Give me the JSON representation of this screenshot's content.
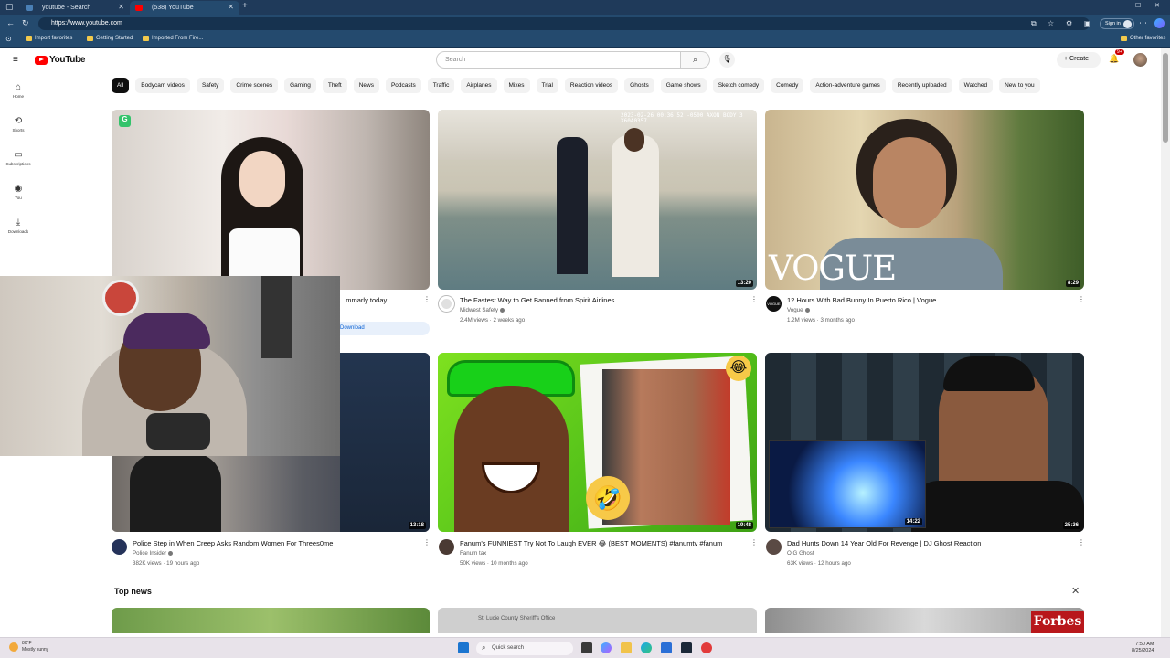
{
  "browser": {
    "tabs": [
      {
        "title": "youtube - Search",
        "active": false
      },
      {
        "title": "(538) YouTube",
        "active": true
      }
    ],
    "url": "https://www.youtube.com",
    "sign_in": "Sign in",
    "favorites": [
      "Import favorites",
      "Getting Started",
      "Imported From Fire...",
      "Other favorites"
    ]
  },
  "youtube": {
    "logo_text": "YouTube",
    "search_placeholder": "Search",
    "create_label": "Create",
    "notification_count": "9+",
    "chips": [
      "All",
      "Bodycam videos",
      "Safety",
      "Crime scenes",
      "Gaming",
      "Theft",
      "News",
      "Podcasts",
      "Traffic",
      "Airplanes",
      "Mixes",
      "Trial",
      "Reaction videos",
      "Ghosts",
      "Game shows",
      "Sketch comedy",
      "Comedy",
      "Action-adventure games",
      "Recently uploaded",
      "Watched",
      "New to you"
    ],
    "nav": [
      {
        "label": "Home",
        "icon": "home-icon"
      },
      {
        "label": "Shorts",
        "icon": "shorts-icon"
      },
      {
        "label": "Subscriptions",
        "icon": "subscriptions-icon"
      },
      {
        "label": "You",
        "icon": "you-icon"
      },
      {
        "label": "Downloads",
        "icon": "downloads-icon"
      }
    ],
    "videos": [
      {
        "title": "...mmarly today.",
        "channel": "",
        "meta": "",
        "duration": "",
        "extra": "Download"
      },
      {
        "title": "The Fastest Way to Get Banned from Spirit Airlines",
        "channel": "Midwest Safety",
        "meta": "2.4M views · 2 weeks ago",
        "duration": "13:20",
        "overlay": "2023-02-26 00:36:52 -0500 AXON BODY 3 X60A0357"
      },
      {
        "title": "12 Hours With Bad Bunny In Puerto Rico | Vogue",
        "channel": "Vogue",
        "meta": "1.2M views · 3 months ago",
        "duration": "8:29",
        "overlay": "VOGUE"
      },
      {
        "title": "Police Step in When Creep Asks Random Women For Threes0me",
        "channel": "Police Insider",
        "meta": "382K views · 19 hours ago",
        "duration": "13:18"
      },
      {
        "title": "Fanum's FUNNIEST Try Not To Laugh EVER 😂 (BEST MOMENTS) #fanumtv #fanum",
        "channel": "Fanum tax",
        "meta": "50K views · 10 months ago",
        "duration": "19:48"
      },
      {
        "title": "Dad Hunts Down 14 Year Old For Revenge | DJ Ghost Reaction",
        "channel": "O.G Ghost",
        "meta": "63K views · 12 hours ago",
        "duration": "25:36",
        "inset_duration": "14:22"
      }
    ],
    "top_news": "Top news",
    "news_overlays": [
      "St. Lucie County Sheriff's Office",
      "Forbes"
    ]
  },
  "taskbar": {
    "weather_temp": "80°F",
    "weather_desc": "Mostly sunny",
    "search": "Quick search",
    "time": "7:50 AM",
    "date": "8/25/2024"
  }
}
